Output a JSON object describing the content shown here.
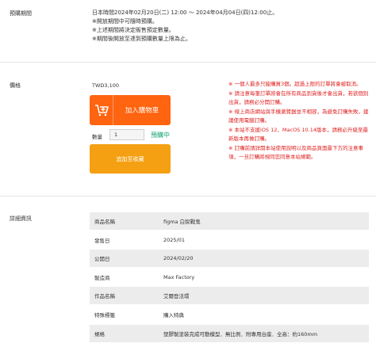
{
  "preorder": {
    "label": "預購期間",
    "lines": [
      "日本時間2024年02月20日(二) 12:00 ～ 2024年04月04日(四)12:00止。",
      "※開放期間中可隨時預購。",
      "※上述期間將決定販售預定數量。",
      "※期間後開放至達到預購數量上限為止。"
    ]
  },
  "price": {
    "label": "價格",
    "value": "TWD3,100"
  },
  "purchase": {
    "add_to_cart": "加入購物車",
    "quantity_label": "數量",
    "quantity_value": "1",
    "status": "預購中",
    "add_to_favorites": "追加至收藏"
  },
  "notices": [
    "※ 一個人最多只能購買3個。超過上限的訂單將會被取消。",
    "※ 請注意每筆訂單將會在所有商品到貨後才會出貨，若欲個別出貨，請務必分開訂購。",
    "※ 缐上商店網站與手機瀏覽器並不相容，為避免訂購失敗，建議使用電腦訂購。",
    "※ 本站不支援iOS 12、MacOS 10.14版本，請務必升級至最新版本再做訂購。",
    "※ 訂購前請詳閱本站使用說明以及商品頁面最下方的注意事項，一旦訂購將視同您同意本站規範。"
  ],
  "details": {
    "label": "詳細資訊",
    "rows": [
      {
        "key": "商品名稱",
        "value": "figma 白猊戰鬼"
      },
      {
        "key": "發售日",
        "value": "2025/01"
      },
      {
        "key": "公開日",
        "value": "2024/02/20"
      },
      {
        "key": "製造商",
        "value": "Max Factory"
      },
      {
        "key": "作品名稱",
        "value": "艾爾登法環"
      },
      {
        "key": "特殊標籤",
        "value": "購入特典"
      },
      {
        "key": "規格",
        "value": "塑膠製塗裝完成可動模型．無比例．附專用台座．全高：約160mm"
      }
    ]
  },
  "colors": {
    "cart_button": "#ff6410",
    "favorites_button": "#f5a012",
    "notice_text": "#e02020",
    "status_text": "#1aa37a"
  }
}
